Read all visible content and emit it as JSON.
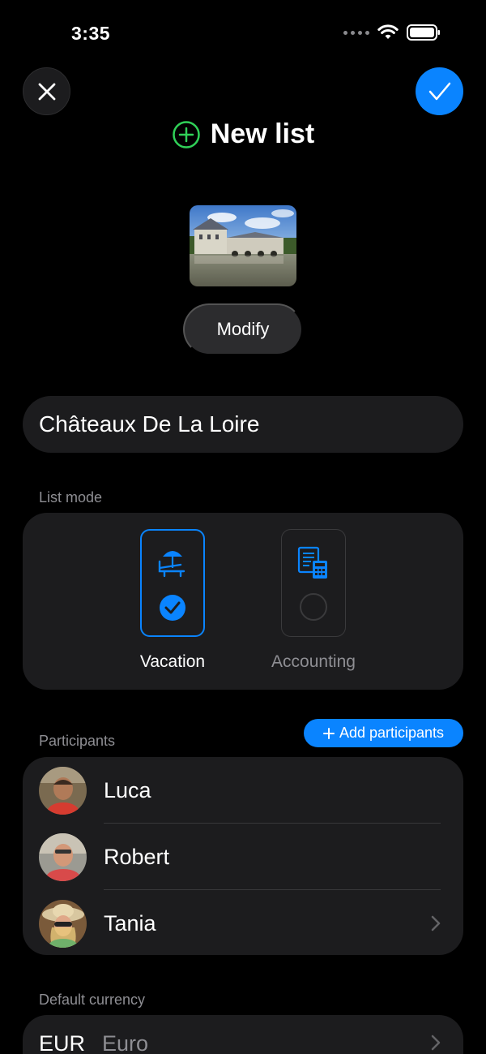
{
  "status_bar": {
    "time": "3:35",
    "icons": [
      "signal-dots-icon",
      "wifi-icon",
      "battery-icon"
    ]
  },
  "header": {
    "title": "New list",
    "close_icon": "close-icon",
    "confirm_icon": "checkmark-icon",
    "title_icon": "plus-circle-icon"
  },
  "photo": {
    "description_icon": "castle-photo",
    "modify_label": "Modify"
  },
  "name_field": {
    "value": "Châteaux De La Loire"
  },
  "list_mode": {
    "label": "List mode",
    "options": [
      {
        "label": "Vacation",
        "icon": "beach-umbrella-icon",
        "selected": true
      },
      {
        "label": "Accounting",
        "icon": "calculator-document-icon",
        "selected": false
      }
    ]
  },
  "participants": {
    "label": "Participants",
    "add_label": "Add participants",
    "items": [
      {
        "name": "Luca"
      },
      {
        "name": "Robert"
      },
      {
        "name": "Tania"
      }
    ]
  },
  "currency": {
    "label": "Default currency",
    "code": "EUR",
    "name": "Euro"
  },
  "colors": {
    "accent": "#0a84ff",
    "green": "#30d158",
    "card": "#1c1c1e",
    "background": "#000000"
  }
}
